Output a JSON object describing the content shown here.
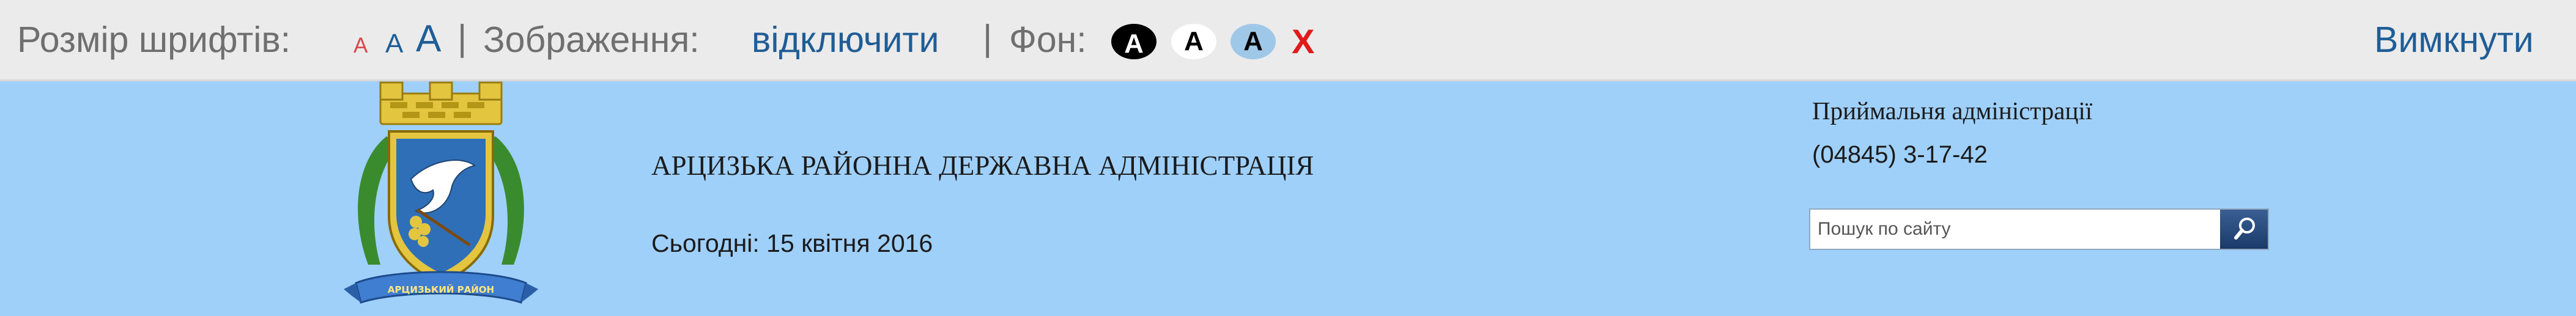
{
  "a11y": {
    "font_size_label": "Розмір шрифтів:",
    "size_small": "A",
    "size_medium": "A",
    "size_large": "A",
    "separator": "|",
    "images_label": "Зображення:",
    "images_toggle": "відключити",
    "background_label": "Фон:",
    "bg_options": [
      "A",
      "A",
      "A"
    ],
    "bg_reset": "X",
    "disable": "Вимкнути",
    "colors": {
      "bar_bg": "#ebebeb",
      "label_gray": "#6f6f6f",
      "link_blue": "#1f5d96",
      "small_red": "#d94a4a",
      "reset_red": "#e01b1b"
    }
  },
  "header": {
    "site_title": "АРЦИЗЬКА РАЙОННА ДЕРЖАВНА АДМІНІСТРАЦІЯ",
    "date_text": "Сьогодні: 15 квітня 2016",
    "reception_label": "Приймальня адміністрації",
    "reception_phone": "(04845) 3-17-42",
    "search_placeholder": "Пошук по сайту",
    "search_icon": "magnifier-icon",
    "emblem_icon": "coat-of-arms-icon",
    "emblem_ribbon_text": "АРЦИЗЬКИЙ РАЙОН",
    "colors": {
      "header_bg": "#9fd0fa",
      "search_button": "#2a4c80"
    }
  }
}
